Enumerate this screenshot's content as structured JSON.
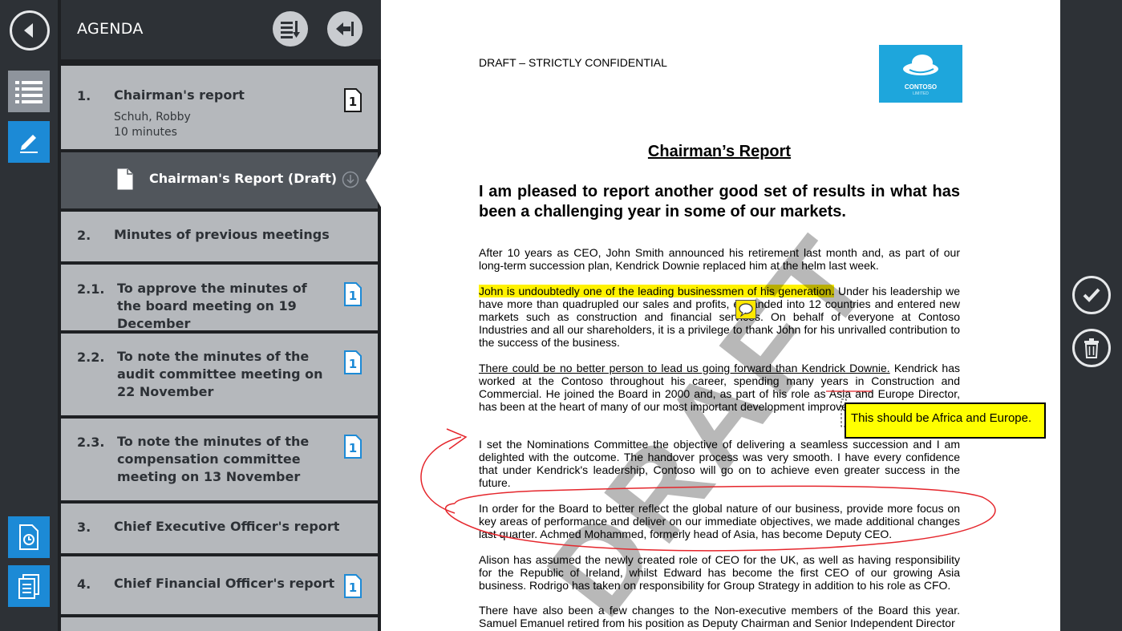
{
  "panel": {
    "title": "AGENDA"
  },
  "agenda": [
    {
      "number": "1.",
      "title": "Chairman's report",
      "presenter": "Schuh, Robby",
      "duration": "10 minutes"
    },
    {
      "document": "Chairman's Report (Draft)"
    },
    {
      "number": "2.",
      "title": "Minutes of previous meetings"
    },
    {
      "number": "2.1.",
      "title": "To approve the minutes of the board meeting on 19 December"
    },
    {
      "number": "2.2.",
      "title": "To note the minutes of the audit committee meeting on 22 November"
    },
    {
      "number": "2.3.",
      "title": "To note the minutes of the compensation committee meeting on 13 November"
    },
    {
      "number": "3.",
      "title": "Chief Executive Officer's report"
    },
    {
      "number": "4.",
      "title": "Chief Financial Officer's report"
    }
  ],
  "doc_badge": "1",
  "document": {
    "header": "DRAFT – STRICTLY CONFIDENTIAL",
    "logo_text": "CONTOSO",
    "logo_sub": "LIMITED",
    "title": "Chairman’s Report",
    "lead": "I am pleased to report another good set of results in what has been a challenging year in some of our markets.",
    "p1": "After 10 years as CEO, John Smith announced his retirement last month and, as part of our long-term succession plan, Kendrick Downie replaced him at the helm last week.",
    "p2_highlight": "John is undoubtedly one of the leading businessmen of his generation.",
    "p2_rest": " Under his leadership we have more than quadrupled our sales and profits, expanded into 12 countries and entered new markets such as construction and financial services. On behalf of everyone at Contoso Industries and all our shareholders, it is a privilege to thank John for his unrivalled contribution to the success of the business.",
    "p3_underline": "There could be no better person to lead us going forward than Kendrick Downie.",
    "p3_rest": " Kendrick has worked at the Contoso throughout his career, spending many years in Construction and Commercial. He joined the Board in 2000 and, as part of his role as Asia and Europe Director, has been at the heart of many of our most important development improvements in recent years.",
    "p4": "I set the Nominations Committee the objective of delivering a seamless succession and I am delighted with the outcome. The handover process was very smooth. I have every confidence that under Kendrick's leadership, Contoso will go on to achieve even greater success in the future.",
    "p5": "In order for the Board to better reflect the global nature of our business, provide more focus on key areas of performance and deliver on our immediate objectives, we made additional changes last quarter. Achmed Mohammed, formerly head of Asia, has become Deputy CEO.",
    "p6": "Alison has assumed the newly created role of CEO for the UK, as well as having responsibility for the Republic of Ireland, whilst Edward has become the first CEO of our growing Asia business. Rodrigo has taken on responsibility for Group Strategy in addition to his role as CFO.",
    "p7": "There have also been a few changes to the Non-executive members of the Board this year. Samuel Emanuel retired from his position as Deputy Chairman and Senior Independent Director",
    "watermark": "DRAFT",
    "annotation": "This should be Africa and Europe."
  },
  "colors": {
    "accent": "#1c8ad6",
    "highlight": "#fff200",
    "ink": "#e5262c"
  }
}
